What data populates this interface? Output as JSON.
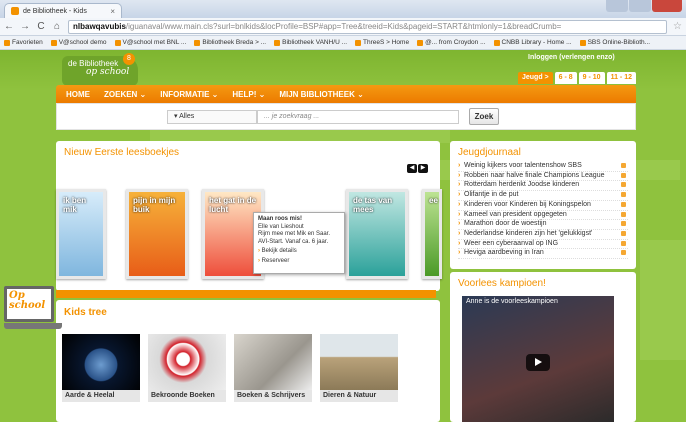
{
  "browser": {
    "tab_title": "de Bibliotheek - Kids",
    "tab_close": "×",
    "url_host": "nlbawqavubis",
    "url_rest": "/iguanaval/www.main.cls?surl=bnlkids&locProfile=BSP#app=Tree&treeid=Kids&pageid=START&htmlonly=1&breadCrumb=",
    "bookmarks": [
      "Favorieten",
      "V@school demo",
      "V@school met BNL ...",
      "Bibliotheek Breda > ...",
      "Bibliotheek VANH/U ...",
      "ThreeS > Home",
      "@... from Croydon ...",
      "CNBB Library - Home ...",
      "SBS Online-Biblioth..."
    ]
  },
  "site": {
    "logo_line1": "de Bibliotheek",
    "logo_line2": "op school",
    "logo_badge": "8",
    "login_text": "Inloggen (verlengen enzo)",
    "age_tabs": [
      "Jeugd >",
      "6 - 8",
      "9 - 10",
      "11 - 12"
    ],
    "nav": [
      "HOME",
      "ZOEKEN ⌄",
      "INFORMATIE ⌄",
      "HELP! ⌄",
      "MIJN BIBLIOTHEEK ⌄"
    ],
    "search": {
      "category": "▾ Alles",
      "placeholder": "... je zoekvraag ...",
      "button": "Zoek"
    }
  },
  "books_panel": {
    "title": "Nieuw Eerste leesboekjes",
    "books": [
      {
        "title": "ik ben mik",
        "color": "blue"
      },
      {
        "title": "pijn in mijn buik",
        "color": "orange"
      },
      {
        "title": "het gat in de lucht",
        "color": "red"
      },
      {
        "title": "de tas van mees",
        "color": "teal"
      },
      {
        "title": "ee",
        "color": "green"
      }
    ],
    "popup": {
      "title": "Maan roos mis!",
      "author": "Elle van Lieshout",
      "desc": "Rijm mee met Mik en Saar. AVI-Start. Vanaf ca. 6 jaar.",
      "action1": "Bekijk details",
      "action2": "Reserveer"
    }
  },
  "kids_tree": {
    "title": "Kids tree",
    "tiles": [
      "Aarde & Heelal",
      "Bekroonde Boeken",
      "Boeken & Schrijvers",
      "Dieren & Natuur"
    ]
  },
  "journal": {
    "title": "Jeugdjournaal",
    "items": [
      "Weinig kijkers voor talentenshow SBS",
      "Robben naar halve finale Champions League",
      "Rotterdam herdenkt Joodse kinderen",
      "Olifantje in de put",
      "Kinderen voor Kinderen bij Koningspelon",
      "Kameel van president opgegeten",
      "Marathon door de woestijn",
      "Nederlandse kinderen zijn het 'gelukkigst'",
      "Weer een cyberaanval op ING",
      "Heviga aardbeving in Iran"
    ]
  },
  "video_panel": {
    "title": "Voorlees kampioen!",
    "video_title": "Anne is de voorleeskampioen"
  },
  "laptop_text": "Op school"
}
